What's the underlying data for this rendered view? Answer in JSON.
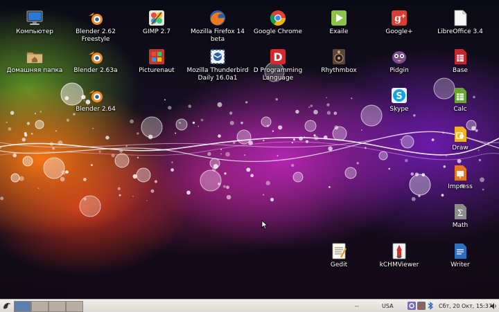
{
  "desktop_icons": [
    {
      "label": "Компьютер",
      "icon": "computer-icon"
    },
    {
      "label": "Blender 2.62 Freestyle",
      "icon": "blender-icon"
    },
    {
      "label": "GIMP 2.7",
      "icon": "gimp-icon"
    },
    {
      "label": "Mozilla Firefox 14 beta",
      "icon": "firefox-icon"
    },
    {
      "label": "Google Chrome",
      "icon": "chrome-icon"
    },
    {
      "label": "Exaile",
      "icon": "exaile-icon"
    },
    {
      "label": "Google+",
      "icon": "google-plus-icon"
    },
    {
      "label": "LibreOffice 3.4",
      "icon": "libreoffice-icon"
    },
    {
      "label": "Домашняя папка",
      "icon": "home-folder-icon"
    },
    {
      "label": "Blender 2.63a",
      "icon": "blender-icon"
    },
    {
      "label": "Picturenaut",
      "icon": "picturenaut-icon"
    },
    {
      "label": "Mozilla Thunderbird Daily 16.0a1",
      "icon": "thunderbird-icon"
    },
    {
      "label": "D Programming Language",
      "icon": "d-language-icon"
    },
    {
      "label": "Rhythmbox",
      "icon": "rhythmbox-icon"
    },
    {
      "label": "Pidgin",
      "icon": "pidgin-icon"
    },
    {
      "label": "Base",
      "icon": "libreoffice-base-icon"
    },
    {
      "label": "Blender 2.64",
      "icon": "blender-icon"
    },
    {
      "label": "Skype",
      "icon": "skype-icon"
    },
    {
      "label": "Calc",
      "icon": "libreoffice-calc-icon"
    },
    {
      "label": "Draw",
      "icon": "libreoffice-draw-icon"
    },
    {
      "label": "Impress",
      "icon": "libreoffice-impress-icon"
    },
    {
      "label": "Math",
      "icon": "libreoffice-math-icon"
    },
    {
      "label": "Gedit",
      "icon": "gedit-icon"
    },
    {
      "label": "kCHMViewer",
      "icon": "kchmviewer-icon"
    },
    {
      "label": "Writer",
      "icon": "libreoffice-writer-icon"
    }
  ],
  "taskbar": {
    "menu_icon": "start-menu-icon",
    "separator_text": "--",
    "keyboard_layout": "USA",
    "clock": "Сбт, 20 Окт, 15:37",
    "workspace_count": 4,
    "active_workspace": 1,
    "tray_icons": [
      "settings-tray-icon",
      "network-tray-icon",
      "bluetooth-icon",
      "volume-icon"
    ]
  },
  "colors": {
    "taskbar_bg": "#e8e5e1",
    "workspace_active": "#5b7fae",
    "workspace_inactive": "#b7aea5"
  }
}
